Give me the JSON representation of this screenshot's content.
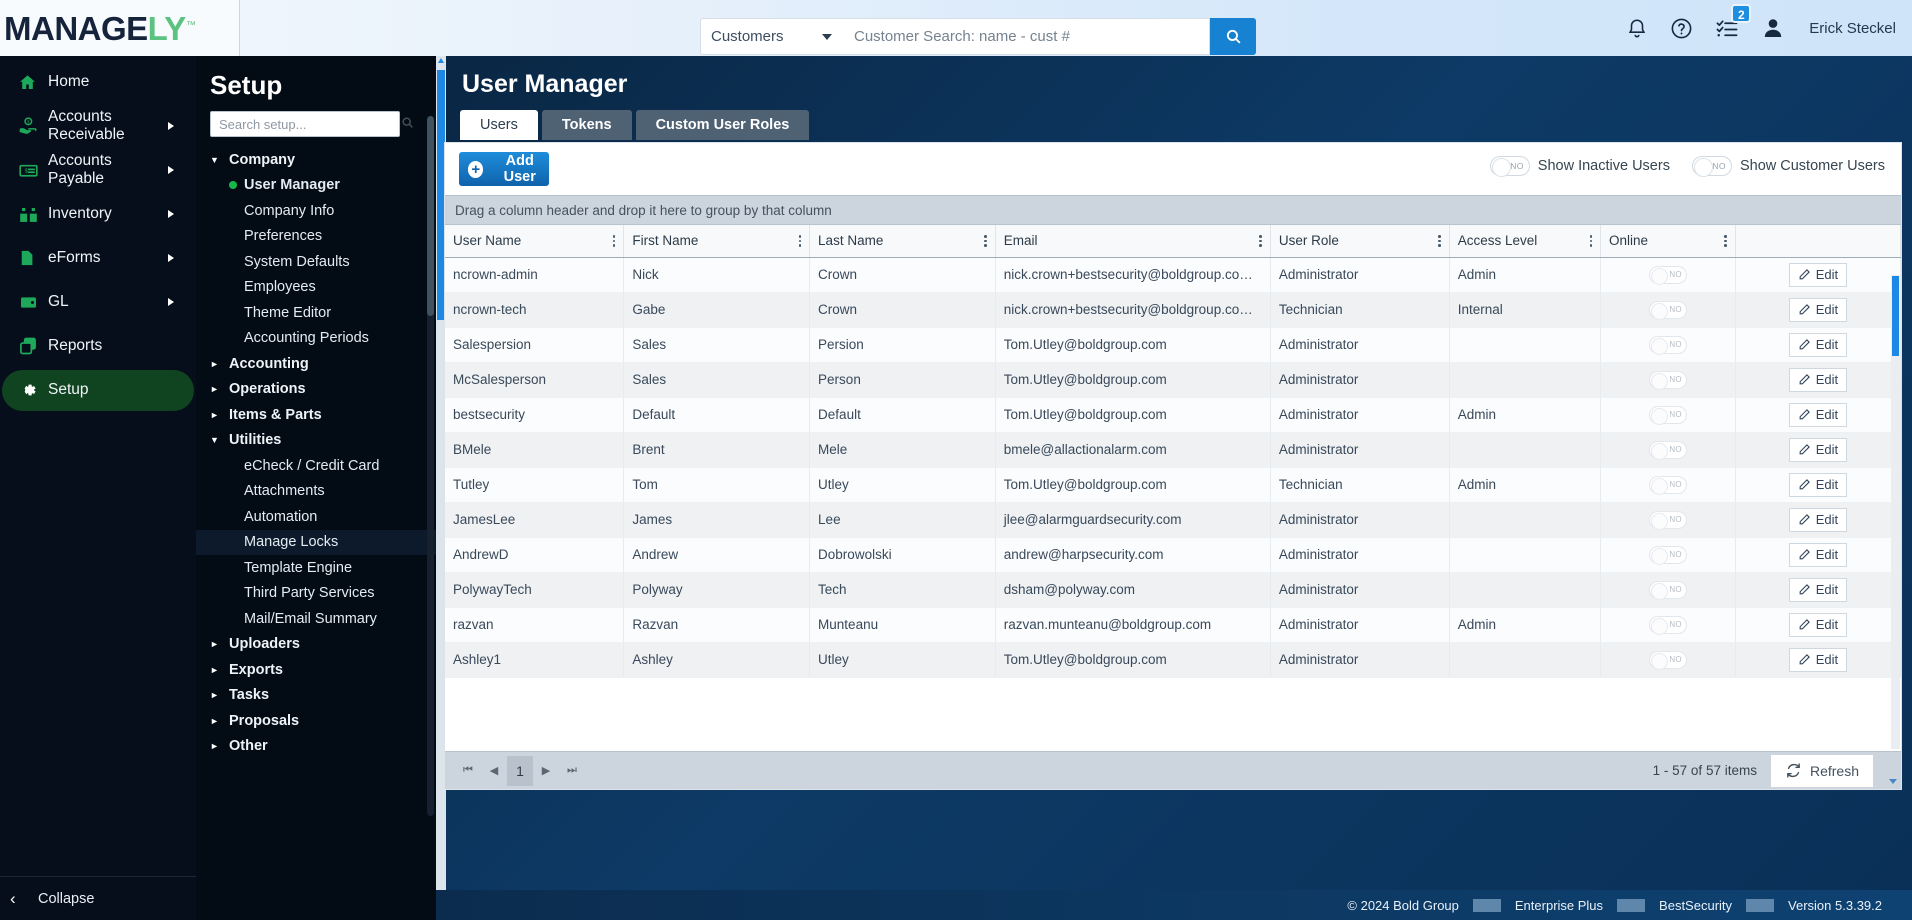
{
  "brand": {
    "name_dark": "MANAGE",
    "name_accent": "LY",
    "tm": "™",
    "accent_color": "#5cc27f"
  },
  "topbar": {
    "search_scope": "Customers",
    "search_placeholder": "Customer Search: name - cust #",
    "search_value": "",
    "notifications_badge": "2",
    "user_name": "Erick Steckel"
  },
  "leftnav": {
    "items": [
      {
        "label": "Home",
        "icon": "home-icon",
        "has_arrow": false,
        "active": false
      },
      {
        "label": "Accounts Receivable",
        "icon": "hand-money-icon",
        "has_arrow": true,
        "active": false
      },
      {
        "label": "Accounts Payable",
        "icon": "banknote-icon",
        "has_arrow": true,
        "active": false
      },
      {
        "label": "Inventory",
        "icon": "boxes-icon",
        "has_arrow": true,
        "active": false
      },
      {
        "label": "eForms",
        "icon": "document-icon",
        "has_arrow": true,
        "active": false
      },
      {
        "label": "GL",
        "icon": "wallet-icon",
        "has_arrow": true,
        "active": false
      },
      {
        "label": "Reports",
        "icon": "copy-icon",
        "has_arrow": false,
        "active": false
      },
      {
        "label": "Setup",
        "icon": "gear-icon",
        "has_arrow": false,
        "active": true
      }
    ],
    "collapse_label": "Collapse"
  },
  "setup": {
    "title": "Setup",
    "search_placeholder": "Search setup...",
    "search_value": "",
    "tree": [
      {
        "type": "group",
        "label": "Company",
        "expanded": true
      },
      {
        "type": "leaf",
        "label": "User Manager",
        "selected": true
      },
      {
        "type": "leaf",
        "label": "Company Info"
      },
      {
        "type": "leaf",
        "label": "Preferences"
      },
      {
        "type": "leaf",
        "label": "System Defaults"
      },
      {
        "type": "leaf",
        "label": "Employees"
      },
      {
        "type": "leaf",
        "label": "Theme Editor"
      },
      {
        "type": "leaf",
        "label": "Accounting Periods"
      },
      {
        "type": "group",
        "label": "Accounting",
        "expanded": false
      },
      {
        "type": "group",
        "label": "Operations",
        "expanded": false
      },
      {
        "type": "group",
        "label": "Items & Parts",
        "expanded": false
      },
      {
        "type": "group",
        "label": "Utilities",
        "expanded": true
      },
      {
        "type": "leaf",
        "label": "eCheck / Credit Card"
      },
      {
        "type": "leaf",
        "label": "Attachments"
      },
      {
        "type": "leaf",
        "label": "Automation"
      },
      {
        "type": "leaf",
        "label": "Manage Locks",
        "hover": true
      },
      {
        "type": "leaf",
        "label": "Template Engine"
      },
      {
        "type": "leaf",
        "label": "Third Party Services"
      },
      {
        "type": "leaf",
        "label": "Mail/Email Summary"
      },
      {
        "type": "group",
        "label": "Uploaders",
        "expanded": false
      },
      {
        "type": "group",
        "label": "Exports",
        "expanded": false
      },
      {
        "type": "group",
        "label": "Tasks",
        "expanded": false
      },
      {
        "type": "group",
        "label": "Proposals",
        "expanded": false
      },
      {
        "type": "group",
        "label": "Other",
        "expanded": false
      }
    ]
  },
  "main": {
    "page_title": "User Manager",
    "tabs": [
      {
        "label": "Users",
        "active": true
      },
      {
        "label": "Tokens",
        "active": false
      },
      {
        "label": "Custom User Roles",
        "active": false
      }
    ],
    "add_user_label": "Add User",
    "toggles": [
      {
        "label": "Show Inactive Users",
        "state": "NO"
      },
      {
        "label": "Show Customer Users",
        "state": "NO"
      }
    ],
    "group_hint": "Drag a column header and drop it here to group by that column",
    "columns": [
      "User Name",
      "First Name",
      "Last Name",
      "Email",
      "User Role",
      "Access Level",
      "Online",
      ""
    ],
    "rows": [
      {
        "user_name": "ncrown-admin",
        "first_name": "Nick",
        "last_name": "Crown",
        "email": "nick.crown+bestsecurity@boldgroup.co…",
        "user_role": "Administrator",
        "access_level": "Admin",
        "online": "NO",
        "edit": "Edit"
      },
      {
        "user_name": "ncrown-tech",
        "first_name": "Gabe",
        "last_name": "Crown",
        "email": "nick.crown+bestsecurity@boldgroup.co…",
        "user_role": "Technician",
        "access_level": "Internal",
        "online": "NO",
        "edit": "Edit"
      },
      {
        "user_name": "Salespersion",
        "first_name": "Sales",
        "last_name": "Persion",
        "email": "Tom.Utley@boldgroup.com",
        "user_role": "Administrator",
        "access_level": "",
        "online": "NO",
        "edit": "Edit"
      },
      {
        "user_name": "McSalesperson",
        "first_name": "Sales",
        "last_name": "Person",
        "email": "Tom.Utley@boldgroup.com",
        "user_role": "Administrator",
        "access_level": "",
        "online": "NO",
        "edit": "Edit"
      },
      {
        "user_name": "bestsecurity",
        "first_name": "Default",
        "last_name": "Default",
        "email": "Tom.Utley@boldgroup.com",
        "user_role": "Administrator",
        "access_level": "Admin",
        "online": "NO",
        "edit": "Edit"
      },
      {
        "user_name": "BMele",
        "first_name": "Brent",
        "last_name": "Mele",
        "email": "bmele@allactionalarm.com",
        "user_role": "Administrator",
        "access_level": "",
        "online": "NO",
        "edit": "Edit"
      },
      {
        "user_name": "Tutley",
        "first_name": "Tom",
        "last_name": "Utley",
        "email": "Tom.Utley@boldgroup.com",
        "user_role": "Technician",
        "access_level": "Admin",
        "online": "NO",
        "edit": "Edit"
      },
      {
        "user_name": "JamesLee",
        "first_name": "James",
        "last_name": "Lee",
        "email": "jlee@alarmguardsecurity.com",
        "user_role": "Administrator",
        "access_level": "",
        "online": "NO",
        "edit": "Edit"
      },
      {
        "user_name": "AndrewD",
        "first_name": "Andrew",
        "last_name": "Dobrowolski",
        "email": "andrew@harpsecurity.com",
        "user_role": "Administrator",
        "access_level": "",
        "online": "NO",
        "edit": "Edit"
      },
      {
        "user_name": "PolywayTech",
        "first_name": "Polyway",
        "last_name": "Tech",
        "email": "dsham@polyway.com",
        "user_role": "Administrator",
        "access_level": "",
        "online": "NO",
        "edit": "Edit"
      },
      {
        "user_name": "razvan",
        "first_name": "Razvan",
        "last_name": "Munteanu",
        "email": "razvan.munteanu@boldgroup.com",
        "user_role": "Administrator",
        "access_level": "Admin",
        "online": "NO",
        "edit": "Edit"
      },
      {
        "user_name": "Ashley1",
        "first_name": "Ashley",
        "last_name": "Utley",
        "email": "Tom.Utley@boldgroup.com",
        "user_role": "Administrator",
        "access_level": "",
        "online": "NO",
        "edit": "Edit"
      }
    ],
    "pager": {
      "page_number": "1",
      "item_count": "1 - 57 of 57 items",
      "refresh_label": "Refresh"
    }
  },
  "footer": {
    "copyright": "© 2024 Bold Group",
    "edition": "Enterprise Plus",
    "tenant": "BestSecurity",
    "version": "Version 5.3.39.2"
  }
}
